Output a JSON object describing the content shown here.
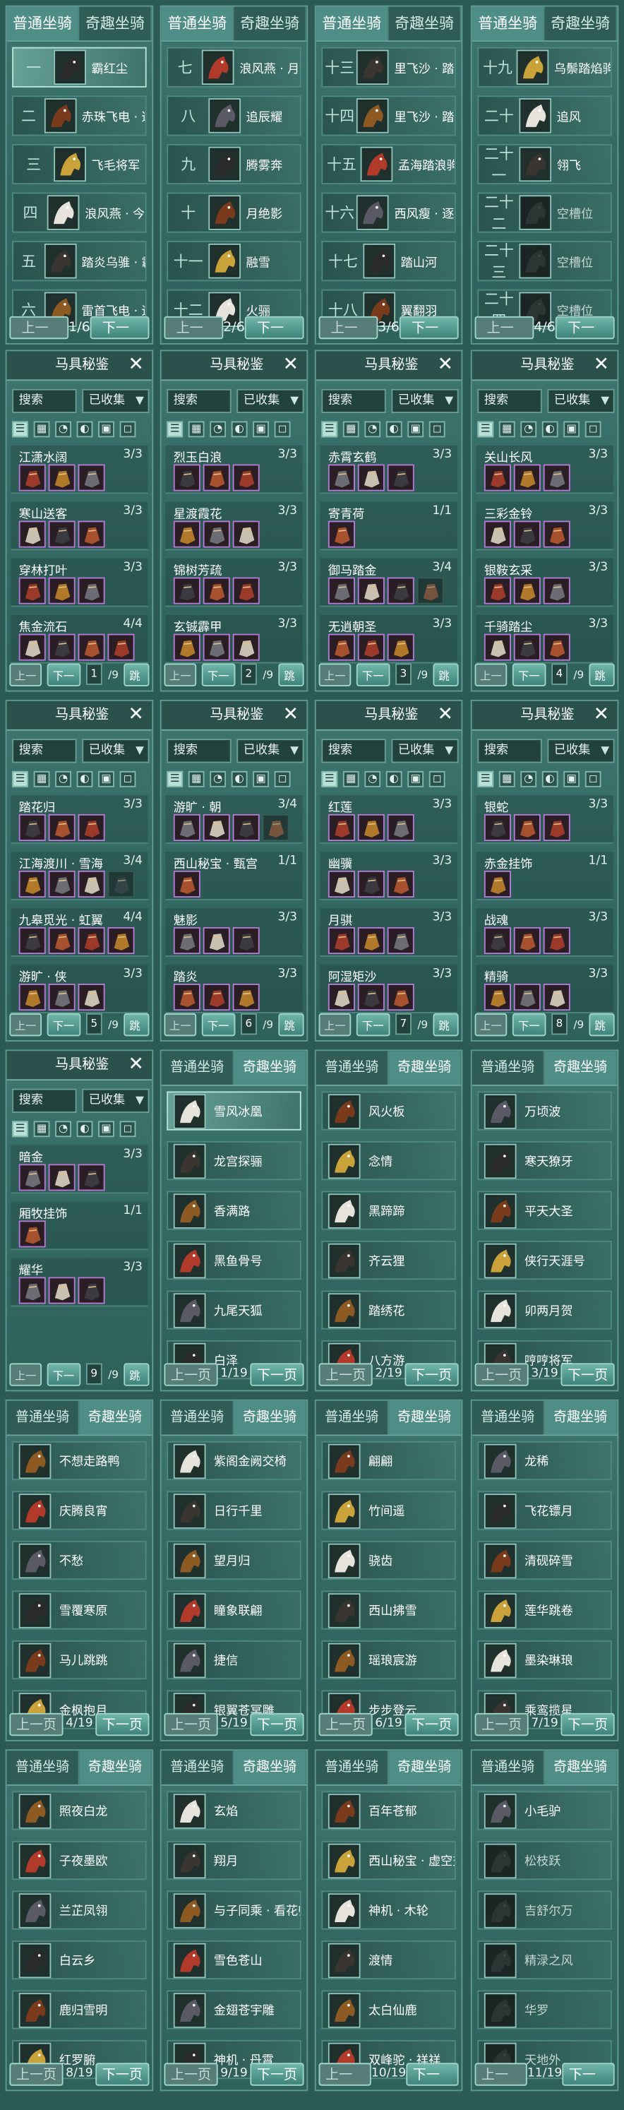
{
  "common": {
    "tab_normal": "普通坐骑",
    "tab_fun": "奇趣坐骑",
    "prev": "上一页",
    "next": "下一页",
    "search": "搜索",
    "filter": "已收集",
    "jump": "跳转",
    "close": "✕",
    "sets_title": "马具秘鉴"
  },
  "mount_pages": [
    {
      "page": "1/6",
      "items": [
        [
          "一",
          "霸红尘"
        ],
        [
          "二",
          "赤珠飞电 · 逐浪"
        ],
        [
          "三",
          "飞毛将军"
        ],
        [
          "四",
          "浪风燕 · 今古"
        ],
        [
          "五",
          "踏炎乌骓 · 霸地"
        ],
        [
          "六",
          "雷首飞电 · 追虹"
        ]
      ]
    },
    {
      "page": "2/6",
      "items": [
        [
          "七",
          "浪风燕 · 月轰"
        ],
        [
          "八",
          "追辰耀"
        ],
        [
          "九",
          "腾雾奔"
        ],
        [
          "十",
          "月绝影"
        ],
        [
          "十一",
          "融雪"
        ],
        [
          "十二",
          "火骊"
        ]
      ]
    },
    {
      "page": "3/6",
      "items": [
        [
          "十三",
          "里飞沙 · 踏秋"
        ],
        [
          "十四",
          "里飞沙 · 踏秋"
        ],
        [
          "十五",
          "孟海踏浪驹"
        ],
        [
          "十六",
          "西风瘦 · 逐狱"
        ],
        [
          "十七",
          "踏山河"
        ],
        [
          "十八",
          "翼翻羽"
        ]
      ]
    },
    {
      "page": "4/6",
      "items": [
        [
          "十九",
          "乌鬃踏焰驹"
        ],
        [
          "二十",
          "追风"
        ],
        [
          "二十一",
          "翎飞"
        ],
        [
          "二十二",
          "空槽位"
        ],
        [
          "二十三",
          "空槽位"
        ],
        [
          "二十四",
          "空槽位"
        ]
      ]
    }
  ],
  "set_pages": [
    {
      "page": "1",
      "total": "/9",
      "sets": [
        [
          "江潇水阔",
          "3/3",
          3
        ],
        [
          "寒山送客",
          "3/3",
          3
        ],
        [
          "穿林打叶",
          "3/3",
          3
        ],
        [
          "焦金流石",
          "4/4",
          4
        ]
      ]
    },
    {
      "page": "2",
      "total": "/9",
      "sets": [
        [
          "烈玉白浪",
          "3/3",
          3
        ],
        [
          "星渡霞花",
          "3/3",
          3
        ],
        [
          "锦树芳疏",
          "3/3",
          3
        ],
        [
          "玄铖霹甲",
          "3/3",
          3
        ]
      ]
    },
    {
      "page": "3",
      "total": "/9",
      "sets": [
        [
          "赤霄玄鹤",
          "3/3",
          3
        ],
        [
          "寄青荷",
          "1/1",
          1
        ],
        [
          "御马踏金",
          "3/4",
          4
        ],
        [
          "无逍朝圣",
          "3/3",
          3
        ]
      ]
    },
    {
      "page": "4",
      "total": "/9",
      "sets": [
        [
          "关山长风",
          "3/3",
          3
        ],
        [
          "三彩金铃",
          "3/3",
          3
        ],
        [
          "银鞍玄采",
          "3/3",
          3
        ],
        [
          "千骑踏尘",
          "3/3",
          3
        ]
      ]
    },
    {
      "page": "5",
      "total": "/9",
      "sets": [
        [
          "踏花归",
          "3/3",
          3
        ],
        [
          "江海渡川 · 雪海",
          "3/4",
          4
        ],
        [
          "九皋觅光 · 虹翼",
          "4/4",
          4
        ],
        [
          "游旷 · 侠",
          "3/3",
          3
        ]
      ]
    },
    {
      "page": "6",
      "total": "/9",
      "sets": [
        [
          "游旷 · 朝",
          "3/4",
          4
        ],
        [
          "西山秘宝 · 甄宫",
          "1/1",
          1
        ],
        [
          "魅影",
          "3/3",
          3
        ],
        [
          "踏炎",
          "3/3",
          3
        ]
      ]
    },
    {
      "page": "7",
      "total": "/9",
      "sets": [
        [
          "红莲",
          "3/3",
          3
        ],
        [
          "幽骥",
          "3/3",
          3
        ],
        [
          "月骐",
          "3/3",
          3
        ],
        [
          "阿湿矩沙",
          "3/3",
          3
        ]
      ]
    },
    {
      "page": "8",
      "total": "/9",
      "sets": [
        [
          "银蛇",
          "3/3",
          3
        ],
        [
          "赤金挂饰",
          "1/1",
          1
        ],
        [
          "战魂",
          "3/3",
          3
        ],
        [
          "精骑",
          "3/3",
          3
        ]
      ]
    },
    {
      "page": "9",
      "total": "/9",
      "sets": [
        [
          "暗金",
          "3/3",
          3
        ],
        [
          "厢牧挂饰",
          "1/1",
          1
        ],
        [
          "耀华",
          "3/3",
          3
        ]
      ]
    }
  ],
  "fun_pages": [
    {
      "page": "1/19",
      "items": [
        "雪风冰凰",
        "龙宫探骊",
        "香满路",
        "黑鱼骨号",
        "九尾天狐",
        "白泽"
      ]
    },
    {
      "page": "2/19",
      "items": [
        "风火板",
        "念情",
        "黑蹄蹄",
        "齐云狸",
        "踏绣花",
        "八方游"
      ]
    },
    {
      "page": "3/19",
      "items": [
        "万顷波",
        "寒天獠牙",
        "平天大圣",
        "侠行天涯号",
        "卯两月贺",
        "哼哼将军"
      ]
    },
    {
      "page": "4/19",
      "items": [
        "不想走路鸭",
        "庆腾良宵",
        "不愁",
        "雪覆寒原",
        "马儿跳跳",
        "金枫抱月"
      ]
    },
    {
      "page": "5/19",
      "items": [
        "紫阁金阙交椅",
        "日行千里",
        "望月归",
        "瞳象联翩",
        "捷信",
        "银翼苍冥雕"
      ]
    },
    {
      "page": "6/19",
      "items": [
        "翩翩",
        "竹间遥",
        "骁齿",
        "西山拂雪",
        "瑶琅宸游",
        "步步登云"
      ]
    },
    {
      "page": "7/19",
      "items": [
        "龙稀",
        "飞花镖月",
        "清砚碎雪",
        "莲华跳卷",
        "墨染琳琅",
        "乘鸾揽星"
      ]
    },
    {
      "page": "8/19",
      "items": [
        "照夜白龙",
        "子夜墨欧",
        "兰芷凤翎",
        "白云乡",
        "鹿归雪明",
        "红罗腑"
      ]
    },
    {
      "page": "9/19",
      "items": [
        "玄焰",
        "翔月",
        "与子同乘 · 看花归",
        "雪色苍山",
        "金翅苍宇雕",
        "神机 · 丹霄"
      ]
    },
    {
      "page": "10/19",
      "items": [
        "百年苍郁",
        "西山秘宝 · 虚空交椅",
        "神机 · 木轮",
        "渡情",
        "太白仙鹿",
        "双峰驼 · 祥祥"
      ]
    },
    {
      "page": "11/19",
      "items": [
        "小毛驴",
        "松枝跃",
        "吉舒尔万",
        "精渌之风",
        "华罗",
        "天地外"
      ]
    }
  ],
  "colors": {
    "accent": "#4f8e86",
    "panel": "#356a64",
    "purple_border": "#b37bd6"
  }
}
